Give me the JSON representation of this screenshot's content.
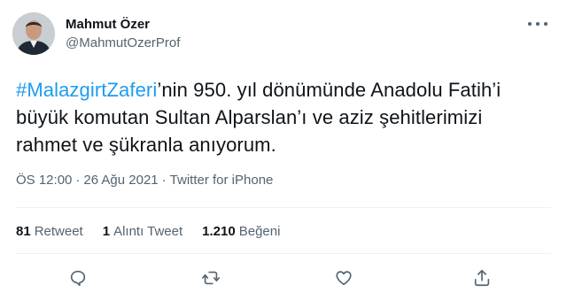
{
  "author": {
    "display_name": "Mahmut Özer",
    "handle": "@MahmutOzerProf"
  },
  "tweet": {
    "hashtag": "#MalazgirtZaferi",
    "text_after_hashtag": "’nin 950. yıl dönümünde Anadolu Fatih’i büyük komutan Sultan Alparslan’ı ve aziz şehitlerimizi rahmet ve şükranla anıyorum."
  },
  "meta": {
    "time": "ÖS 12:00",
    "separator": "·",
    "date": "26 Ağu 2021",
    "source": "Twitter for iPhone"
  },
  "stats": {
    "retweets_count": "81",
    "retweets_label": "Retweet",
    "quotes_count": "1",
    "quotes_label": "Alıntı Tweet",
    "likes_count": "1.210",
    "likes_label": "Beğeni"
  },
  "icons": {
    "reply": "reply-icon",
    "retweet": "retweet-icon",
    "like": "heart-icon",
    "share": "share-icon",
    "more": "more-icon"
  },
  "colors": {
    "hashtag": "#1d9bf0",
    "secondary_text": "#536471",
    "primary_text": "#0f1419"
  }
}
